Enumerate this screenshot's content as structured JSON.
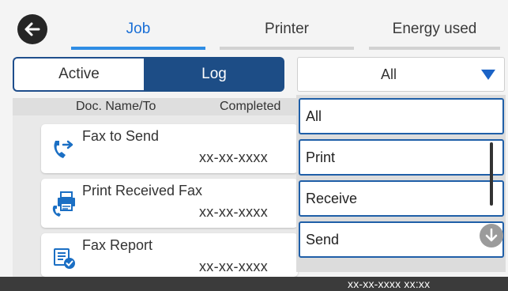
{
  "header": {
    "back_icon": "arrow-left-icon",
    "tabs": [
      {
        "label": "Job",
        "selected": true
      },
      {
        "label": "Printer",
        "selected": false
      },
      {
        "label": "Energy used",
        "selected": false
      }
    ]
  },
  "mode_toggle": {
    "active_label": "Active",
    "log_label": "Log",
    "selected": "Log"
  },
  "filter": {
    "value": "All",
    "options": [
      "All",
      "Print",
      "Receive",
      "Send"
    ]
  },
  "columns": {
    "doc_name": "Doc. Name/To",
    "completed": "Completed"
  },
  "jobs": [
    {
      "name": "Fax to Send",
      "date": "xx-xx-xxxx",
      "icon": "fax-send-icon"
    },
    {
      "name": "Print Received Fax",
      "date": "xx-xx-xxxx",
      "icon": "fax-print-received-icon"
    },
    {
      "name": "Fax Report",
      "date": "xx-xx-xxxx",
      "icon": "fax-report-icon"
    }
  ],
  "status_bar": {
    "datetime": "xx-xx-xxxx xx:xx"
  },
  "colors": {
    "accent_tab": "#2f8de4",
    "selected_segment": "#1d4d86",
    "dropdown_border": "#1f5fa8",
    "fax_icon_blue": "#1b6fc4"
  }
}
